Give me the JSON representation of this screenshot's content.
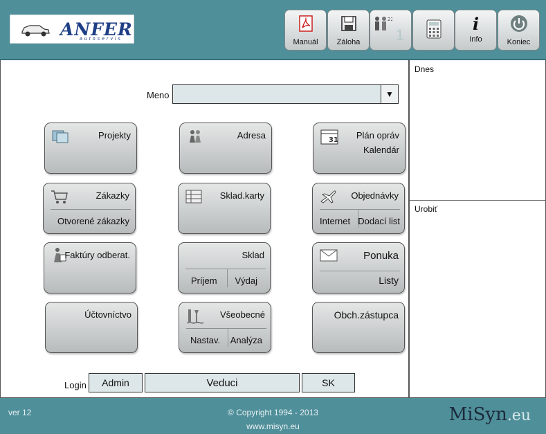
{
  "header": {
    "logo_text": "ANFER",
    "logo_sub": "autoservis",
    "toolbar": [
      {
        "label": "Manuál",
        "icon": "pdf-icon"
      },
      {
        "label": "Záloha",
        "icon": "floppy-icon"
      },
      {
        "label": "",
        "icon": "users-icon",
        "count": "1"
      },
      {
        "label": "",
        "icon": "calculator-icon"
      },
      {
        "label": "Info",
        "icon": "info-icon"
      },
      {
        "label": "Koniec",
        "icon": "power-icon"
      }
    ]
  },
  "form": {
    "meno_label": "Meno",
    "meno_value": ""
  },
  "tiles": {
    "projekty": {
      "title": "Projekty"
    },
    "adresa": {
      "title": "Adresa"
    },
    "plan": {
      "title": "Plán opráv",
      "line2": "Kalendár"
    },
    "zakazky": {
      "title": "Zákazky",
      "sub": "Otvorené zákazky"
    },
    "sklad_karty": {
      "title": "Sklad.karty"
    },
    "objednavky": {
      "title": "Objednávky",
      "sub_l": "Internet",
      "sub_r": "Dodací list"
    },
    "faktury": {
      "title": "Faktúry odberat."
    },
    "sklad": {
      "title": "Sklad",
      "sub_l": "Príjem",
      "sub_r": "Výdaj"
    },
    "ponuka": {
      "title": "Ponuka",
      "sub": "Listy"
    },
    "uctovnictvo": {
      "title": "Účtovníctvo"
    },
    "vseobecne": {
      "title": "Všeobecné",
      "sub_l": "Nastav.",
      "sub_r": "Analýza"
    },
    "obch": {
      "title": "Obch.zástupca"
    }
  },
  "login": {
    "label": "Login",
    "user": "Admin",
    "role": "Veduci",
    "lang": "SK"
  },
  "side": {
    "today": "Dnes",
    "todo": "Urobiť"
  },
  "footer": {
    "version": "ver 12",
    "copyright": "©  Copyright 1994 - 2013",
    "url": "www.misyn.eu",
    "brand": "MiSyn",
    "brand_tld": ".eu"
  }
}
